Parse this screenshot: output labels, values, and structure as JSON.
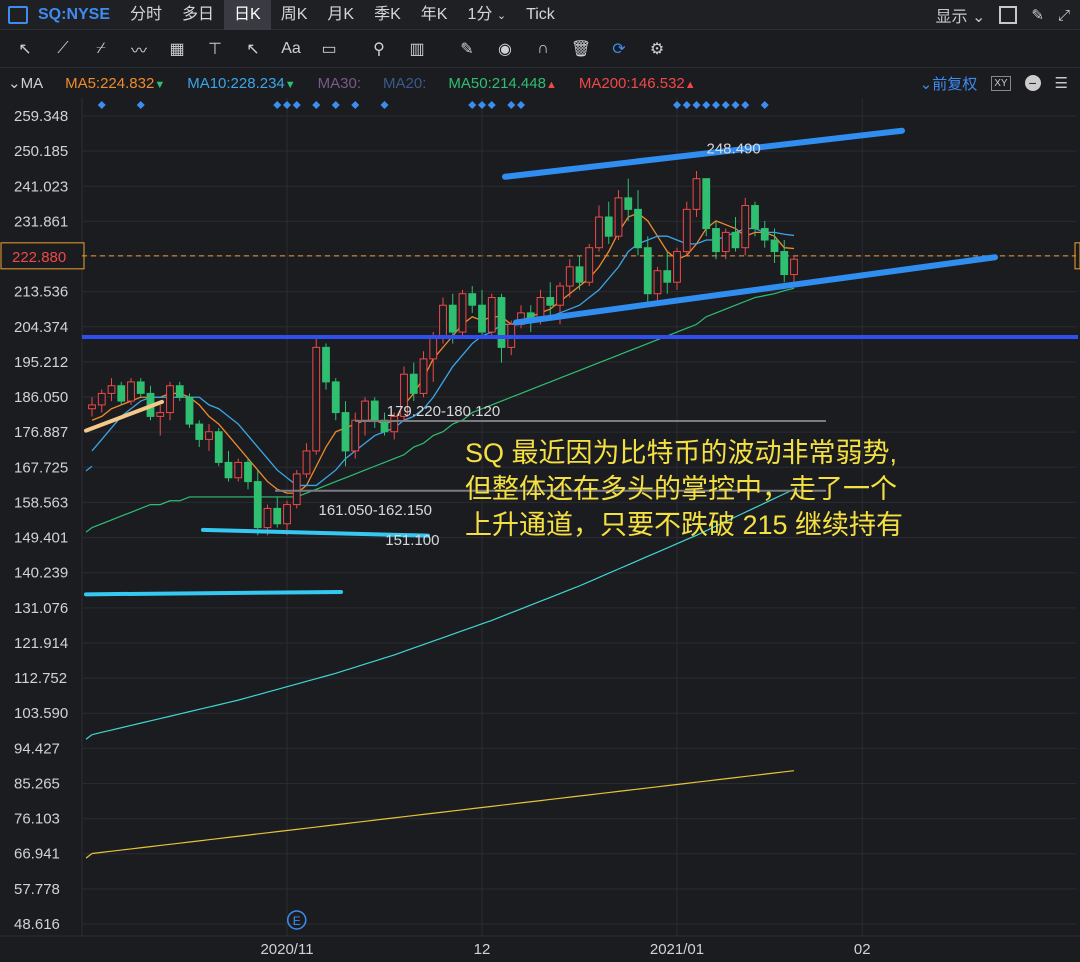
{
  "header": {
    "symbol": "SQ:NYSE",
    "periods": [
      "分时",
      "多日",
      "日K",
      "周K",
      "月K",
      "季K",
      "年K"
    ],
    "active_period": "日K",
    "minute_select": "1分",
    "tick_label": "Tick",
    "display_label": "显示"
  },
  "toolbar": {
    "icons": [
      "cursor-icon",
      "line-tool-icon",
      "channel-tool-icon",
      "wave-tool-icon",
      "fib-tool-icon",
      "hline-tool-icon",
      "arrow-tool-icon",
      "text-tool-icon",
      "comment-tool-icon",
      "search-icon",
      "indicator-icon",
      "pen-icon",
      "eye-icon",
      "magnet-icon",
      "trash-icon",
      "sync-icon",
      "gear-icon"
    ],
    "text_tool_label": "Aa"
  },
  "ma_bar": {
    "label": "MA",
    "items": [
      {
        "text": "MA5:224.832",
        "color": "#f08a2a",
        "arrow": "▼",
        "arrow_color": "#2fbf71"
      },
      {
        "text": "MA10:228.234",
        "color": "#3aa6e8",
        "arrow": "▼",
        "arrow_color": "#2fbf71"
      },
      {
        "text": "MA30:",
        "color": "#7a5a88",
        "arrow": "",
        "arrow_color": ""
      },
      {
        "text": "MA20:",
        "color": "#3a5a8a",
        "arrow": "",
        "arrow_color": ""
      },
      {
        "text": "MA50:214.448",
        "color": "#2fbf71",
        "arrow": "▲",
        "arrow_color": "#f04848"
      },
      {
        "text": "MA200:146.532",
        "color": "#f04848",
        "arrow": "▲",
        "arrow_color": "#f04848"
      }
    ],
    "adjust_label": "前复权"
  },
  "colors": {
    "up": "#f04848",
    "down": "#2fbf71",
    "ma5": "#f08a2a",
    "ma10": "#3aa6e8",
    "ma50": "#2fbf71",
    "ma200": "#40d6d0",
    "ma_long": "#e8c23a",
    "grid": "#2a2b31",
    "channel": "#2f8ef0",
    "hline": "#2f4ff0",
    "annotation": "#f5e042"
  },
  "chart_data": {
    "type": "candlestick",
    "y_ticks": [
      259.348,
      250.185,
      241.023,
      231.861,
      222.88,
      213.536,
      204.374,
      195.212,
      186.05,
      176.887,
      167.725,
      158.563,
      149.401,
      140.239,
      131.076,
      121.914,
      112.752,
      103.59,
      94.427,
      85.265,
      76.103,
      66.941,
      57.778,
      48.616
    ],
    "ylim": [
      48.616,
      259.348
    ],
    "current_price": "222.880",
    "x_labels": [
      {
        "i": 20,
        "text": "2020/11"
      },
      {
        "i": 40,
        "text": "12"
      },
      {
        "i": 60,
        "text": "2021/01"
      },
      {
        "i": 79,
        "text": "02"
      }
    ],
    "price_labels": [
      {
        "i": 62,
        "v": 248.49,
        "text": "248.490"
      },
      {
        "i": 29,
        "v": 179.22,
        "text": "179.220-180.120"
      },
      {
        "i": 22,
        "v": 161.05,
        "text": "161.050-162.150"
      },
      {
        "i": 27,
        "v": 151.1,
        "text": "151.100"
      }
    ],
    "earnings_marker": "E",
    "ohlc": [
      [
        183,
        186,
        181,
        184
      ],
      [
        184,
        188,
        182,
        187
      ],
      [
        187,
        191,
        185,
        189
      ],
      [
        189,
        190,
        184,
        185
      ],
      [
        185,
        191,
        184,
        190
      ],
      [
        190,
        191,
        186,
        187
      ],
      [
        187,
        189,
        180,
        181
      ],
      [
        181,
        184,
        176,
        182
      ],
      [
        182,
        190,
        180,
        189
      ],
      [
        189,
        190,
        185,
        186
      ],
      [
        186,
        187,
        178,
        179
      ],
      [
        179,
        180,
        173,
        175
      ],
      [
        175,
        179,
        172,
        177
      ],
      [
        177,
        178,
        168,
        169
      ],
      [
        169,
        172,
        164,
        165
      ],
      [
        165,
        170,
        164,
        169
      ],
      [
        169,
        170,
        162,
        164
      ],
      [
        164,
        167,
        150,
        152
      ],
      [
        152,
        158,
        150,
        157
      ],
      [
        157,
        160,
        152,
        153
      ],
      [
        153,
        159,
        150,
        158
      ],
      [
        158,
        167,
        157,
        166
      ],
      [
        166,
        174,
        165,
        172
      ],
      [
        172,
        202,
        171,
        199
      ],
      [
        199,
        200,
        188,
        190
      ],
      [
        190,
        191,
        180,
        182
      ],
      [
        182,
        185,
        168,
        172
      ],
      [
        172,
        182,
        170,
        180
      ],
      [
        180,
        186,
        176,
        185
      ],
      [
        185,
        186,
        178,
        180
      ],
      [
        180,
        182,
        176,
        177
      ],
      [
        177,
        182,
        175,
        181
      ],
      [
        181,
        194,
        180,
        192
      ],
      [
        192,
        195,
        185,
        187
      ],
      [
        187,
        198,
        186,
        196
      ],
      [
        196,
        203,
        190,
        202
      ],
      [
        202,
        212,
        200,
        210
      ],
      [
        210,
        213,
        200,
        203
      ],
      [
        203,
        214,
        202,
        213
      ],
      [
        213,
        215,
        208,
        210
      ],
      [
        210,
        214,
        202,
        203
      ],
      [
        203,
        213,
        202,
        212
      ],
      [
        212,
        213,
        195,
        199
      ],
      [
        199,
        206,
        197,
        205
      ],
      [
        205,
        210,
        204,
        208
      ],
      [
        208,
        210,
        203,
        206
      ],
      [
        206,
        214,
        205,
        212
      ],
      [
        212,
        216,
        207,
        210
      ],
      [
        210,
        216,
        205,
        215
      ],
      [
        215,
        222,
        212,
        220
      ],
      [
        220,
        223,
        214,
        216
      ],
      [
        216,
        226,
        215,
        225
      ],
      [
        225,
        236,
        224,
        233
      ],
      [
        233,
        237,
        226,
        228
      ],
      [
        228,
        240,
        227,
        238
      ],
      [
        238,
        243,
        232,
        235
      ],
      [
        235,
        240,
        223,
        225
      ],
      [
        225,
        228,
        210,
        213
      ],
      [
        213,
        220,
        210,
        219
      ],
      [
        219,
        224,
        213,
        216
      ],
      [
        216,
        225,
        214,
        224
      ],
      [
        224,
        237,
        223,
        235
      ],
      [
        235,
        245,
        233,
        243
      ],
      [
        243,
        243,
        228,
        230
      ],
      [
        230,
        232,
        222,
        224
      ],
      [
        224,
        230,
        222,
        229
      ],
      [
        229,
        233,
        224,
        225
      ],
      [
        225,
        238,
        223,
        236
      ],
      [
        236,
        237,
        228,
        230
      ],
      [
        230,
        232,
        225,
        227
      ],
      [
        227,
        230,
        221,
        224
      ],
      [
        224,
        227,
        216,
        218
      ],
      [
        218,
        223,
        215,
        222
      ]
    ],
    "series": [
      {
        "values": [
          180,
          181,
          183,
          184,
          185,
          186,
          186,
          186,
          187,
          187,
          186,
          184,
          181,
          179,
          176,
          173,
          170,
          167,
          164,
          162,
          161,
          161,
          163,
          168,
          173,
          177,
          178,
          179,
          180,
          180,
          179,
          180,
          184,
          187,
          191,
          196,
          199,
          202,
          205,
          207,
          206,
          207,
          207,
          205,
          206,
          207,
          208,
          209,
          211,
          213,
          215,
          217,
          220,
          224,
          229,
          233,
          234,
          232,
          228,
          224,
          222,
          223,
          226,
          230,
          232,
          231,
          230,
          228,
          229,
          229,
          228,
          225,
          224.8
        ]
      },
      {
        "values": [
          172,
          175,
          178,
          181,
          183,
          185,
          186,
          186,
          186,
          186,
          186,
          186,
          184,
          183,
          181,
          179,
          176,
          173,
          170,
          167,
          165,
          163,
          163,
          163,
          165,
          167,
          170,
          172,
          174,
          176,
          177,
          178,
          180,
          181,
          183,
          186,
          190,
          194,
          197,
          200,
          202,
          203,
          205,
          205,
          206,
          206,
          206,
          207,
          208,
          209,
          210,
          212,
          214,
          217,
          220,
          224,
          226,
          227,
          228,
          228,
          227,
          226,
          226,
          227,
          227,
          228,
          229,
          230,
          230,
          229,
          229,
          228.5,
          228.2
        ]
      },
      {
        "values": [
          152,
          153,
          154,
          155,
          156,
          157,
          158,
          158,
          159,
          159,
          160,
          160,
          160,
          160,
          160,
          160,
          160,
          160,
          160,
          160,
          160,
          160,
          161,
          162,
          163,
          164,
          165,
          166,
          167,
          168,
          169,
          170,
          171,
          173,
          174,
          176,
          177,
          179,
          180,
          182,
          183,
          184,
          185,
          186,
          187,
          188,
          189,
          190,
          191,
          192,
          193,
          194,
          195,
          196,
          197,
          198,
          199,
          200,
          201,
          202,
          203,
          204,
          205,
          207,
          208,
          209,
          210,
          211,
          212,
          212.5,
          213,
          213.8,
          214.4
        ]
      },
      {
        "values": [
          98,
          98.6,
          99.2,
          99.8,
          100.4,
          101,
          101.6,
          102.2,
          102.8,
          103.4,
          104,
          104.6,
          105.2,
          105.8,
          106.4,
          107,
          107.7,
          108.4,
          109.1,
          109.8,
          110.5,
          111.2,
          111.9,
          112.6,
          113.3,
          114,
          114.8,
          115.6,
          116.4,
          117.2,
          118,
          118.8,
          119.7,
          120.6,
          121.5,
          122.4,
          123.3,
          124.2,
          125.1,
          126,
          126.9,
          127.8,
          128.8,
          129.8,
          130.8,
          131.8,
          132.8,
          133.8,
          134.8,
          135.8,
          136.8,
          137.9,
          139,
          140.1,
          141.2,
          142.3,
          143.4,
          144.5,
          145.6,
          146.7,
          147.8,
          148.9,
          150,
          151.2,
          152.4,
          153.6,
          154.8,
          156,
          157.2,
          158.4,
          159.6,
          160.8,
          162
        ]
      },
      {
        "values": [
          67,
          67.3,
          67.6,
          67.9,
          68.2,
          68.5,
          68.8,
          69.1,
          69.4,
          69.7,
          70,
          70.3,
          70.6,
          70.9,
          71.2,
          71.5,
          71.8,
          72.1,
          72.4,
          72.7,
          73,
          73.3,
          73.6,
          73.9,
          74.2,
          74.5,
          74.8,
          75.1,
          75.4,
          75.7,
          76,
          76.3,
          76.6,
          76.9,
          77.2,
          77.5,
          77.8,
          78.1,
          78.4,
          78.7,
          79,
          79.3,
          79.6,
          79.9,
          80.2,
          80.5,
          80.8,
          81.1,
          81.4,
          81.7,
          82,
          82.3,
          82.6,
          82.9,
          83.2,
          83.5,
          83.8,
          84.1,
          84.4,
          84.7,
          85,
          85.3,
          85.6,
          85.9,
          86.2,
          86.5,
          86.8,
          87.1,
          87.4,
          87.7,
          88,
          88.3,
          88.6
        ]
      }
    ],
    "annotations": {
      "text_lines": [
        "SQ 最近因为比特币的波动非常弱势,",
        "但整体还在多头的掌控中，走了一个",
        "上升通道，只要不跌破 215 继续持有"
      ]
    }
  }
}
